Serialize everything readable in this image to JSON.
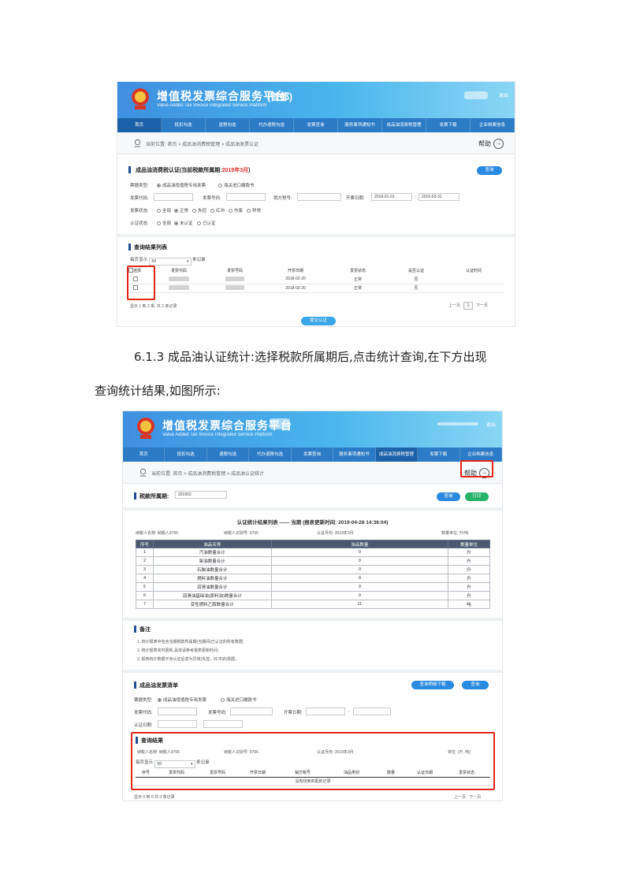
{
  "shared": {
    "brand_title": "增值税发票综合服务平台",
    "brand_sub": "Value Added Tax Invoice Integrated Service Platform",
    "logout": "退出",
    "help": "帮助",
    "crumb_prefix": "当前位置:",
    "nav": [
      "首页",
      "抵扣勾选",
      "退税勾选",
      "代办退税勾选",
      "发票查询",
      "服务事项通知书",
      "成品油消费税管理",
      "发票下载",
      "企业档案信息"
    ],
    "nav2": [
      "首页",
      "抵扣勾选",
      "退税勾选",
      "代办退税勾选",
      "发票查询",
      "服务事项通知书",
      "成品油消费税管理",
      "发票下载",
      "企业档案信息"
    ]
  },
  "shot1": {
    "region": "(首都)",
    "crumb": "首页 > 成品油消费税管理 > 成品油发票认证",
    "section_title": "成品油消费税认证",
    "period_note": "(当前税款所属期:",
    "period_value": "2019年3月",
    "period_close": ")",
    "query_btn": "查询",
    "invoice_type_label": "票据类型:",
    "invoice_type_opt1": "成品油增值税专用发票",
    "invoice_type_opt2": "海关进口缴款书",
    "code_label": "发票代码:",
    "num_label": "发票号码:",
    "seller_label": "销方税号:",
    "date_label": "开票日期:",
    "date_from": "2018-01-01",
    "date_to": "2015-03-31",
    "status_label": "发票状态:",
    "status_opts": [
      "全部",
      "正常",
      "失控",
      "红冲",
      "作废",
      "异常"
    ],
    "cert_label": "认证状态:",
    "cert_opts": [
      "全部",
      "未认证",
      "已认证"
    ],
    "result_title": "查询结果列表",
    "per_page_label": "每页显示",
    "per_page_value": "50",
    "per_page_suffix": "条记录",
    "columns": [
      "选择",
      "发票代码",
      "发票号码",
      "开票日期",
      "发票状态",
      "是否认证",
      "认证时间"
    ],
    "rows": [
      {
        "date": "2018-02-20",
        "status": "正常",
        "certified": "否"
      },
      {
        "date": "2018-02-20",
        "status": "正常",
        "certified": "否"
      }
    ],
    "summary": "显示 1 到 2 条, 共 2 条记录",
    "prev": "上一页",
    "page": "1",
    "next": "下一页",
    "submit_btn": "提交认证"
  },
  "paragraph": {
    "line1": "6.1.3 成品油认证统计:选择税款所属期后,点击统计查询,在下方出现",
    "line2": "查询统计结果,如图所示:"
  },
  "shot2": {
    "crumb": "首页 > 成品油消费税管理 > 成品油认证统计",
    "period_label": "税款所属期:",
    "period_value": "201903",
    "query_btn": "查询",
    "print_btn": "打印",
    "table_title": "认证统计结果列表 —— 当期 (报表更新时间: 2019-04-28 14:36:04)",
    "taxpayer_name_label": "纳税人名称:",
    "taxpayer_name": "纳税人9766",
    "taxpayer_id_label": "纳税人识别号:",
    "taxpayer_id": "9766",
    "cert_month_label": "认证月份:",
    "cert_month": "2019年3月",
    "unit_label": "数量单位:",
    "unit": "升/吨",
    "columns": [
      "序号",
      "油品名称",
      "油品数量",
      "数量单位"
    ],
    "rows": [
      {
        "no": "1",
        "name": "汽油数量合计",
        "qty": "0",
        "unit": "升"
      },
      {
        "no": "2",
        "name": "柴油数量合计",
        "qty": "0",
        "unit": "升"
      },
      {
        "no": "3",
        "name": "石脑油数量合计",
        "qty": "0",
        "unit": "升"
      },
      {
        "no": "4",
        "name": "燃料油数量合计",
        "qty": "0",
        "unit": "升"
      },
      {
        "no": "5",
        "name": "润滑油数量合计",
        "qty": "0",
        "unit": "升"
      },
      {
        "no": "6",
        "name": "润滑油基础油(原料油)数量合计",
        "qty": "0",
        "unit": "升"
      },
      {
        "no": "7",
        "name": "变性燃料乙醇数量合计",
        "qty": "11",
        "unit": "吨"
      }
    ],
    "notes_title": "备注",
    "notes": [
      "1. 统计报表中包含当期税款所属期(当期间)已认证的所有数据;",
      "2. 统计报表实时更新,具体请参考报表更新时间;",
      "3. 报表统计数据不含认证后变为异常(失控、红冲)的票据。"
    ],
    "list_title": "成品油发票清单",
    "detail_btn": "查询明细下载",
    "query2_btn": "查询",
    "type_label": "票据类型:",
    "type_opt1": "成品油增值税专用发票",
    "type_opt2": "海关进口缴款书",
    "code_label": "发票代码:",
    "num_label": "发票号码:",
    "date_label": "开票日期:",
    "cert_date_label": "认证日期:",
    "result_title": "查询结果",
    "unit2_label": "单位:",
    "unit2": "(升, 吨)",
    "per_page_label": "每页显示",
    "per_page_value": "50",
    "per_page_suffix": "条记录",
    "result_columns": [
      "序号",
      "发票代码",
      "发票号码",
      "开票日期",
      "销方税号",
      "油品类别",
      "数量",
      "认证日期",
      "发票状态"
    ],
    "empty": "没有找到匹配的记录",
    "summary": "显示 0 到 0 共 0 条记录",
    "prev": "上一页",
    "next": "下一页"
  }
}
